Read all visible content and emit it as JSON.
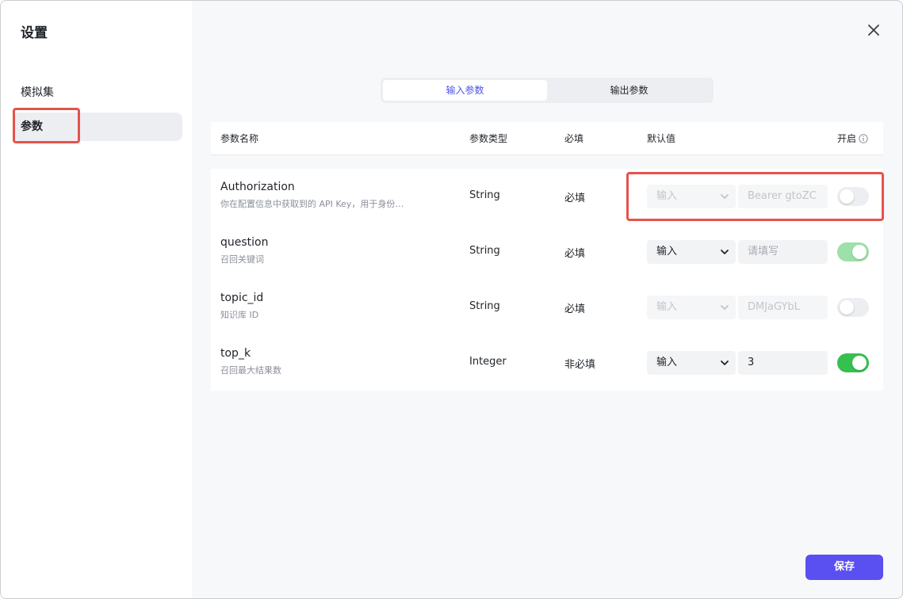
{
  "sidebar": {
    "title": "设置",
    "items": [
      {
        "label": "模拟集"
      },
      {
        "label": "参数"
      }
    ]
  },
  "tabs": [
    {
      "label": "输入参数"
    },
    {
      "label": "输出参数"
    }
  ],
  "table": {
    "headers": {
      "name": "参数名称",
      "type": "参数类型",
      "required": "必填",
      "default": "默认值",
      "enabled": "开启"
    },
    "rows": [
      {
        "name": "Authorization",
        "desc": "你在配置信息中获取到的 API Key，用于身份…",
        "type": "String",
        "required": "必填",
        "source": "输入",
        "value": "Bearer gtoZC",
        "enabled": false,
        "disabled": true
      },
      {
        "name": "question",
        "desc": "召回关键词",
        "type": "String",
        "required": "必填",
        "source": "输入",
        "value": "请填写",
        "enabled": true,
        "disabled": false
      },
      {
        "name": "topic_id",
        "desc": "知识库 ID",
        "type": "String",
        "required": "必填",
        "source": "输入",
        "value": "DMJaGYbL",
        "enabled": false,
        "disabled": true
      },
      {
        "name": "top_k",
        "desc": "召回最大结果数",
        "type": "Integer",
        "required": "非必填",
        "source": "输入",
        "value": "3",
        "enabled": true,
        "disabled": false
      }
    ]
  },
  "footer": {
    "save_label": "保存"
  },
  "colors": {
    "accent": "#4d53e8",
    "primary_button": "#5a4ff0",
    "toggle_on": "#35c050",
    "highlight": "#e5534b"
  }
}
